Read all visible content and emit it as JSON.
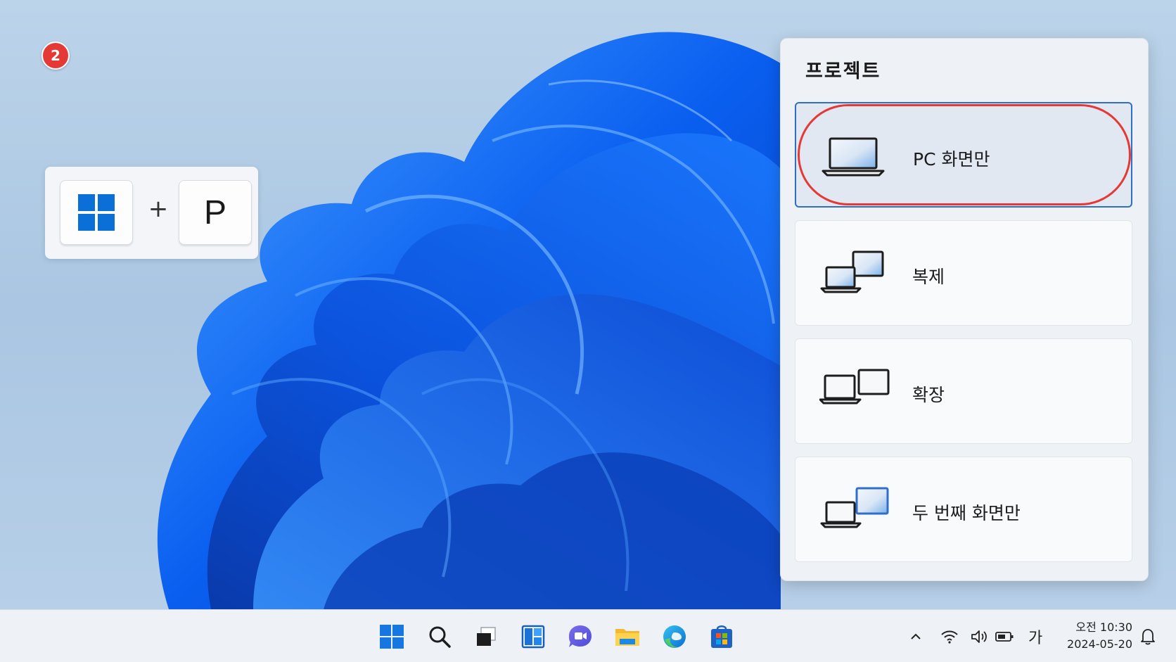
{
  "step_badge": "2",
  "shortcut": {
    "key_windows": "windows-logo-key",
    "plus": "+",
    "key_letter": "P"
  },
  "project_panel": {
    "title": "프로젝트",
    "options": [
      {
        "label": "PC 화면만",
        "icon": "pc-screen-only-icon",
        "selected": true
      },
      {
        "label": "복제",
        "icon": "duplicate-icon",
        "selected": false
      },
      {
        "label": "확장",
        "icon": "extend-icon",
        "selected": false
      },
      {
        "label": "두 번째 화면만",
        "icon": "second-screen-only-icon",
        "selected": false
      }
    ]
  },
  "taskbar": {
    "apps": [
      "start-icon",
      "search-icon",
      "task-view-icon",
      "widgets-icon",
      "chat-icon",
      "file-explorer-icon",
      "edge-icon",
      "store-icon"
    ],
    "tray": {
      "ime_label": "가",
      "time": "오전 10:30",
      "date": "2024-05-20"
    }
  },
  "colors": {
    "accent": "#2f6fc9",
    "highlight": "#e53935",
    "windows_blue": "#0a6fd6"
  }
}
